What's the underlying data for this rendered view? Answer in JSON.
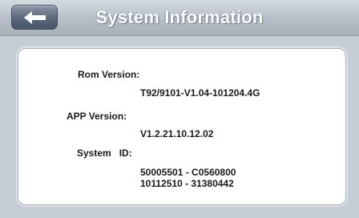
{
  "header": {
    "title": "System Information",
    "back_icon": "left-arrow-icon"
  },
  "info": {
    "rom_label": "Rom Version:",
    "rom_value": "T92/9101-V1.04-101204.4G",
    "app_label": "APP Version:",
    "app_value": "V1.2.21.10.12.02",
    "system_id_label": "System   ID:",
    "system_id_line1": "50005501 - C0560800",
    "system_id_line2": "10112510 - 31380442"
  }
}
